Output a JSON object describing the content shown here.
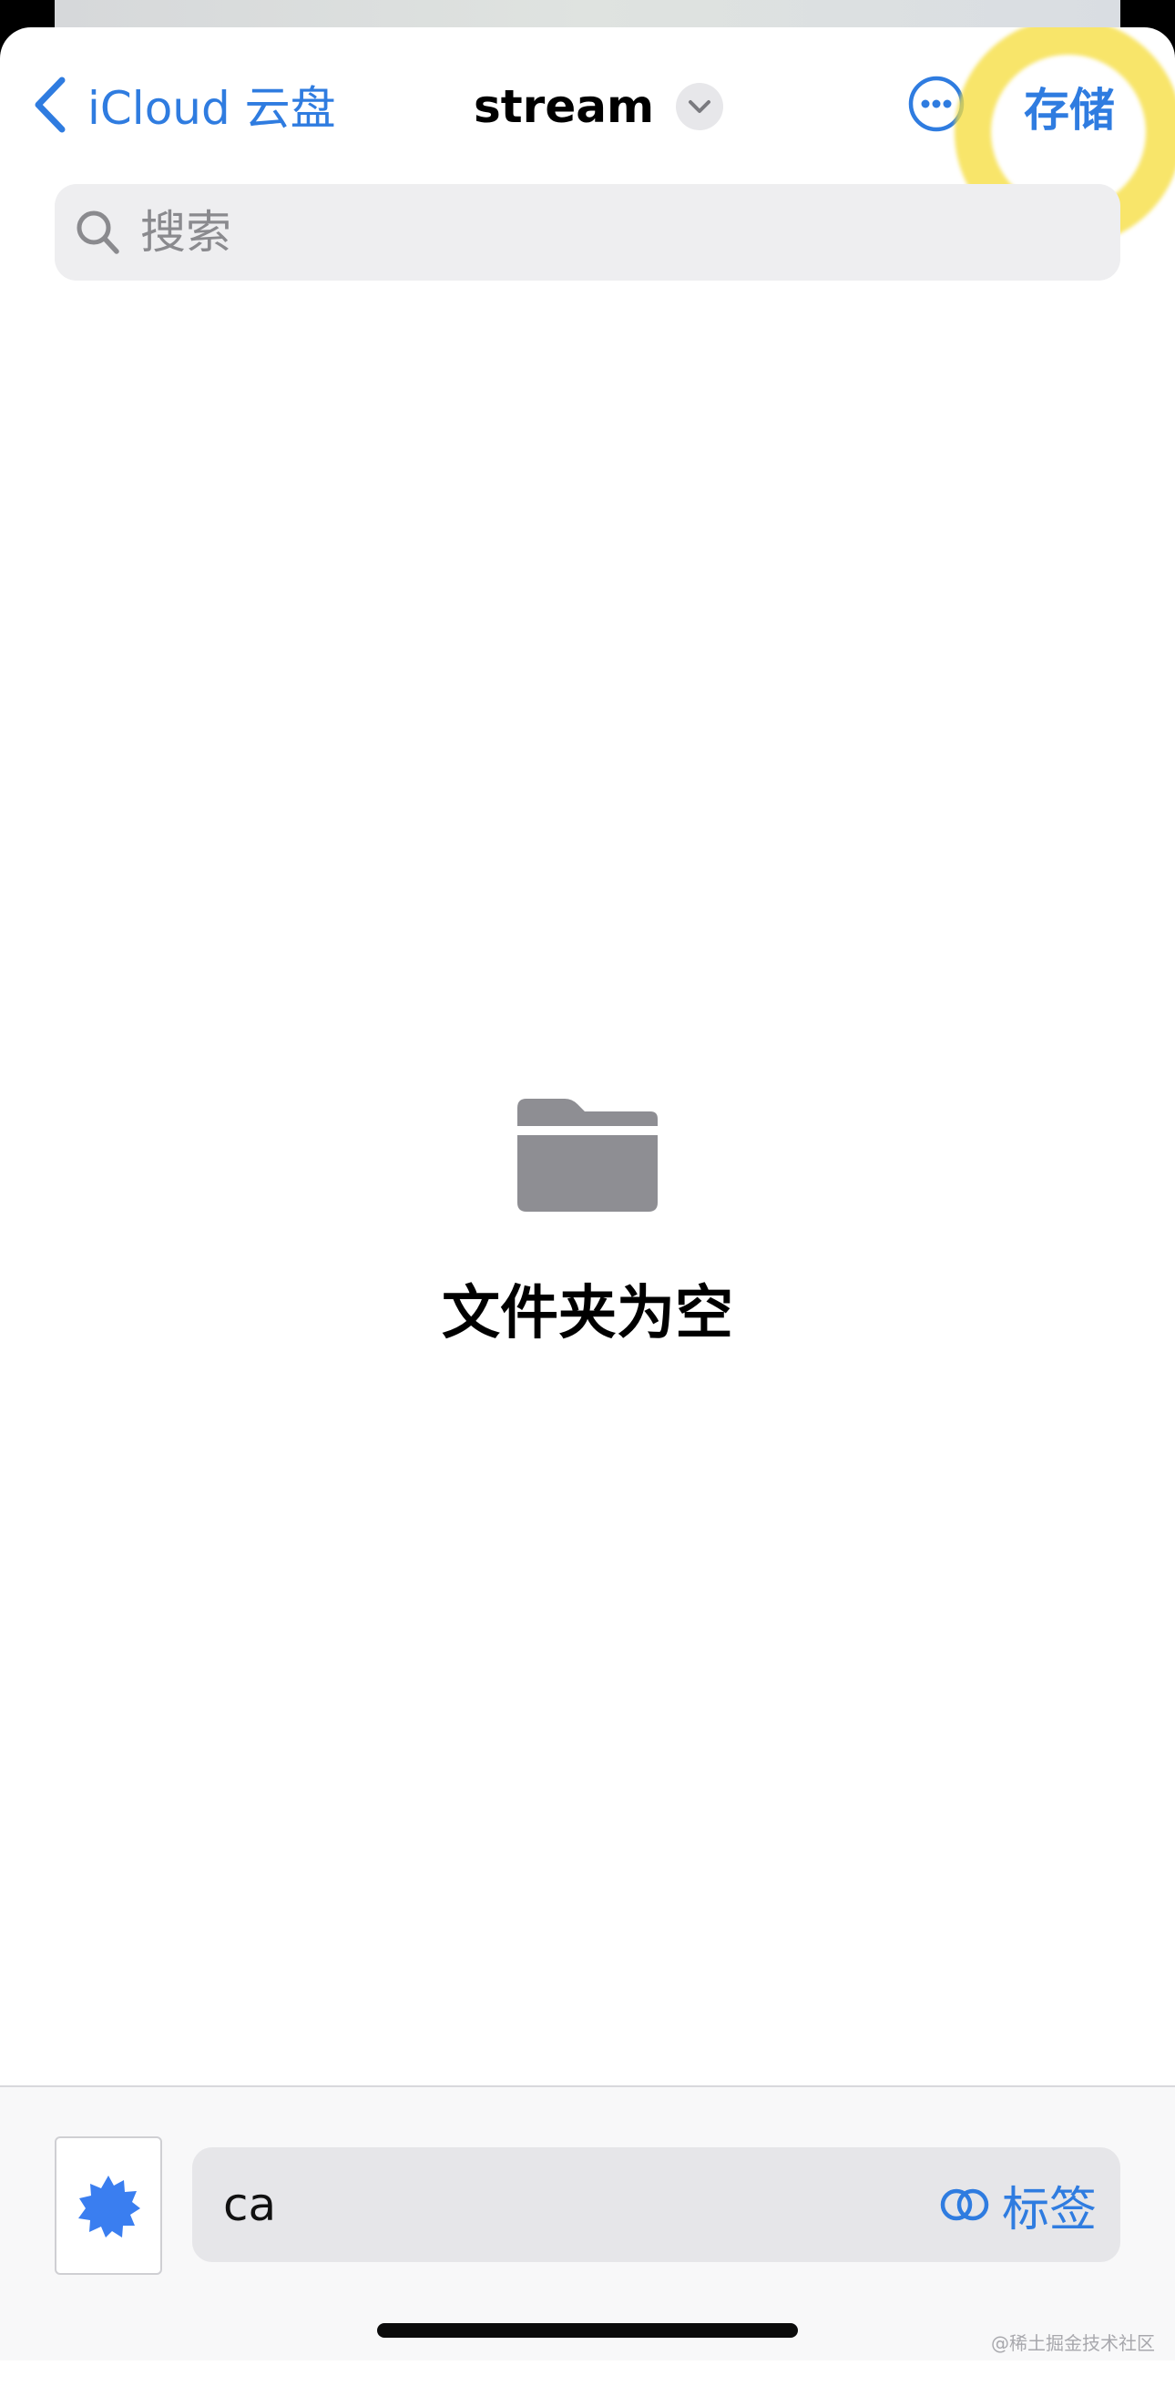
{
  "nav": {
    "back_label": "iCloud 云盘",
    "title": "stream",
    "save_label": "存储"
  },
  "search": {
    "placeholder": "搜索"
  },
  "empty_state": {
    "message": "文件夹为空"
  },
  "bottom": {
    "filename_value": "ca",
    "tags_label": "标签"
  },
  "watermark": "@稀土掘金技术社区",
  "colors": {
    "accent": "#2f7ce0",
    "highlight": "#f6de40",
    "folder": "#8e8e93"
  },
  "icons": [
    "chevron-left-icon",
    "chevron-down-icon",
    "more-icon",
    "search-icon",
    "folder-icon",
    "app-icon",
    "tags-icon"
  ]
}
